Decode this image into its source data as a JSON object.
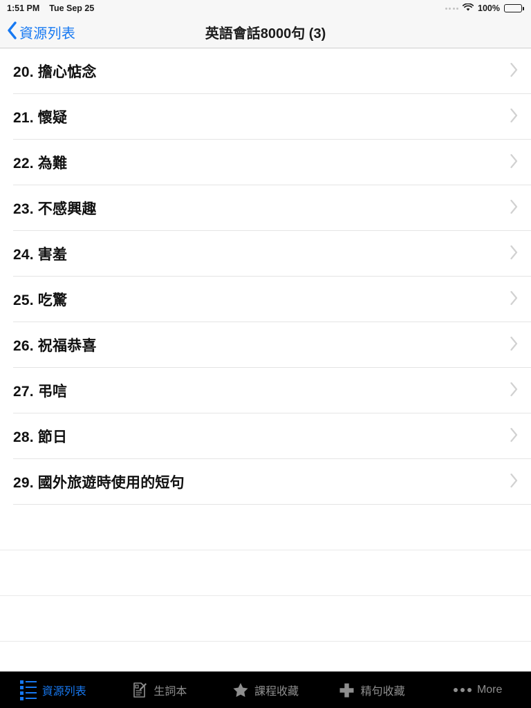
{
  "status_bar": {
    "time": "1:51 PM",
    "date": "Tue Sep 25",
    "signal_icon": "signal-dots-icon",
    "wifi_icon": "wifi-icon",
    "battery_percent": "100%",
    "battery_icon": "battery-full-icon"
  },
  "nav": {
    "back_icon": "chevron-left-icon",
    "back_label": "資源列表",
    "title": "英語會話8000句 (3)"
  },
  "list": {
    "disclosure_icon": "chevron-right-icon",
    "rows": [
      {
        "num": "20.",
        "label": "擔心惦念"
      },
      {
        "num": "21.",
        "label": "懷疑"
      },
      {
        "num": "22.",
        "label": "為難"
      },
      {
        "num": "23.",
        "label": "不感興趣"
      },
      {
        "num": "24.",
        "label": "害羞"
      },
      {
        "num": "25.",
        "label": "吃驚"
      },
      {
        "num": "26.",
        "label": "祝福恭喜"
      },
      {
        "num": "27.",
        "label": "弔唁"
      },
      {
        "num": "28.",
        "label": "節日"
      },
      {
        "num": "29.",
        "label": "國外旅遊時使用的短句"
      }
    ],
    "empty_row_count": 4
  },
  "tabbar": {
    "active_index": 0,
    "active_color": "#1779f2",
    "inactive_color": "#8e8e8e",
    "background": "#000000",
    "tabs": [
      {
        "label": "資源列表",
        "icon": "list-bullet-icon"
      },
      {
        "label": "生詞本",
        "icon": "compose-document-icon"
      },
      {
        "label": "課程收藏",
        "icon": "star-icon"
      },
      {
        "label": "精句收藏",
        "icon": "plus-cross-icon"
      },
      {
        "label": "More",
        "icon": "ellipsis-icon"
      }
    ]
  }
}
